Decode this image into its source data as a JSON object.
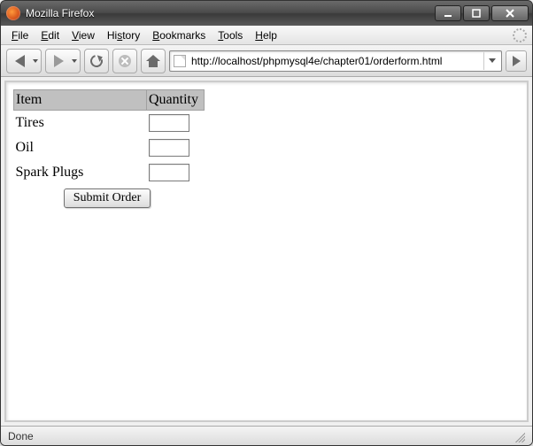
{
  "window": {
    "title": "Mozilla Firefox"
  },
  "menu": {
    "file": "File",
    "edit": "Edit",
    "view": "View",
    "history": "History",
    "bookmarks": "Bookmarks",
    "tools": "Tools",
    "help": "Help"
  },
  "toolbar": {
    "url": "http://localhost/phpmysql4e/chapter01/orderform.html"
  },
  "form": {
    "headers": {
      "item": "Item",
      "quantity": "Quantity"
    },
    "rows": [
      {
        "label": "Tires",
        "value": ""
      },
      {
        "label": "Oil",
        "value": ""
      },
      {
        "label": "Spark Plugs",
        "value": ""
      }
    ],
    "submit_label": "Submit Order"
  },
  "status": {
    "text": "Done"
  }
}
